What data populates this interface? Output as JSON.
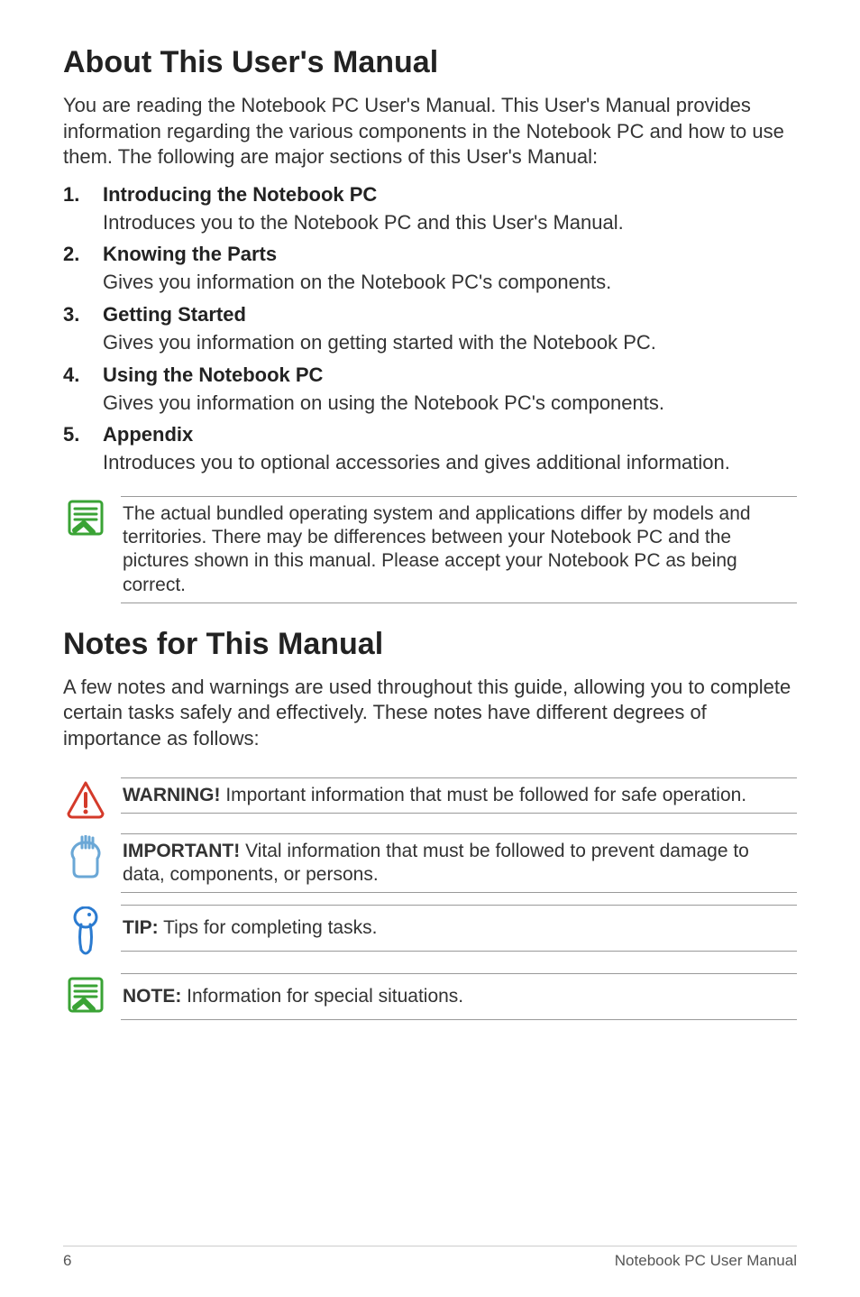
{
  "headings": {
    "h1a": "About This User's Manual",
    "h1b": "Notes for This Manual"
  },
  "intro_a": "You are reading the Notebook PC User's Manual. This User's Manual provides information regarding the various components in the Notebook PC and how to use them. The following are major sections of this User's Manual:",
  "sections": [
    {
      "title": "Introducing the Notebook PC",
      "desc": "Introduces you to the Notebook PC and this User's Manual."
    },
    {
      "title": "Knowing the Parts",
      "desc": "Gives you information on the Notebook PC's components."
    },
    {
      "title": "Getting Started",
      "desc": "Gives you information on getting started with the Notebook PC."
    },
    {
      "title": "Using the Notebook PC",
      "desc": "Gives you information on using the Notebook PC's components."
    },
    {
      "title": "Appendix",
      "desc": "Introduces you to optional accessories and gives additional information."
    }
  ],
  "note_bundled": "The actual bundled operating system and applications differ by models and territories. There may be differences between your Notebook PC and the pictures shown in this manual. Please accept your Notebook PC as being correct.",
  "intro_b": "A few notes and warnings are used throughout this guide, allowing you to complete certain tasks safely and effectively. These notes have different degrees of importance as follows:",
  "callouts": {
    "warning_label": "WARNING!",
    "warning_text": " Important information that must be followed for safe operation.",
    "important_label": "IMPORTANT!",
    "important_text": " Vital information that must be followed to prevent damage to data, components, or persons.",
    "tip_label": "TIP:",
    "tip_text": " Tips for completing tasks.",
    "note_label": "NOTE:",
    "note_text": "  Information for special situations."
  },
  "footer": {
    "page": "6",
    "doc_title": "Notebook PC User Manual"
  },
  "colors": {
    "note_green": "#3aa335",
    "warning_red": "#d43a2a",
    "important_blue": "#6aa7d6",
    "tip_blue": "#2b7bd0"
  }
}
